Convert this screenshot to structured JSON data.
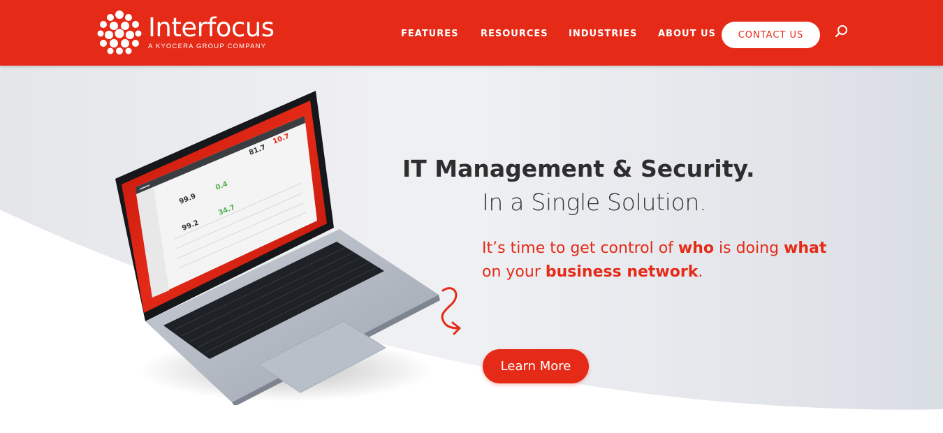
{
  "brand": {
    "name": "Interfocus",
    "tagline": "A KYOCERA GROUP COMPANY",
    "color": "#e52a17"
  },
  "nav": {
    "items": [
      {
        "label": "FEATURES"
      },
      {
        "label": "RESOURCES"
      },
      {
        "label": "INDUSTRIES"
      },
      {
        "label": "ABOUT US"
      }
    ],
    "contact_label": "CONTACT US",
    "search_icon": "search-icon"
  },
  "hero": {
    "headline": "IT Management & Security.",
    "subheadline": "In a Single Solution.",
    "tagline": {
      "t1": "It’s time to get control of ",
      "b1": "who",
      "t2": " is doing ",
      "b2": "what",
      "t3": "on your ",
      "b3": "business network",
      "t4": "."
    },
    "cta_label": "Learn More"
  },
  "laptop_screen": {
    "metrics": [
      "99.9",
      "0.4",
      "99.2",
      "34.7",
      "81.7",
      "10.7"
    ]
  }
}
